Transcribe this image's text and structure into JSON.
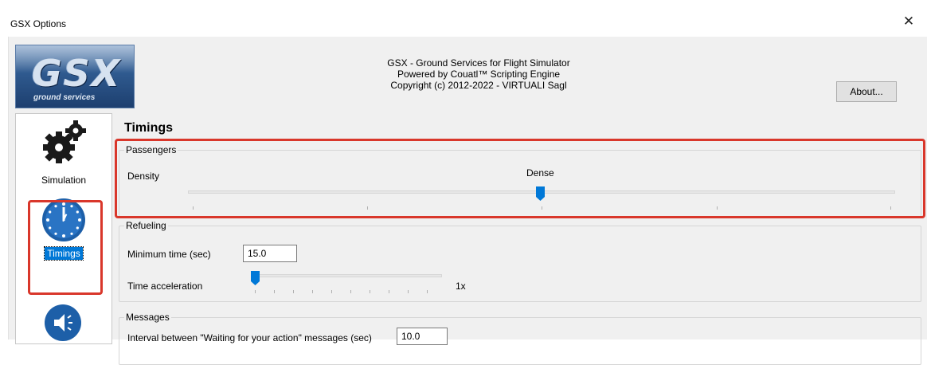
{
  "window": {
    "title": "GSX Options",
    "close_glyph": "✕"
  },
  "header": {
    "logo_text": "GSX",
    "logo_subtext": "ground services",
    "line1": "GSX - Ground Services for Flight Simulator",
    "line2": "Powered by Couatl™ Scripting Engine",
    "line3": "Copyright (c) 2012-2022 - VIRTUALI Sagl",
    "about_label": "About..."
  },
  "sidebar": {
    "items": [
      {
        "label": "Simulation",
        "icon": "gears-icon",
        "selected": false
      },
      {
        "label": "Timings",
        "icon": "clock-icon",
        "selected": true
      },
      {
        "label": "",
        "icon": "speaker-icon",
        "selected": false
      }
    ]
  },
  "page": {
    "title": "Timings",
    "passengers": {
      "legend": "Passengers",
      "density_label": "Density",
      "density_value": "Dense",
      "slider_fraction": 0.5
    },
    "refueling": {
      "legend": "Refueling",
      "min_time_label": "Minimum time (sec)",
      "min_time_value": "15.0",
      "time_accel_label": "Time acceleration",
      "time_accel_value": "1x",
      "slider_fraction": 0.0
    },
    "messages": {
      "legend": "Messages",
      "interval_label": "Interval between \"Waiting for your action\" messages (sec)",
      "interval_value": "10.0"
    }
  },
  "colors": {
    "accent": "#0078d7",
    "annotation": "#d9372b",
    "window_bg": "#f0f0f0"
  }
}
